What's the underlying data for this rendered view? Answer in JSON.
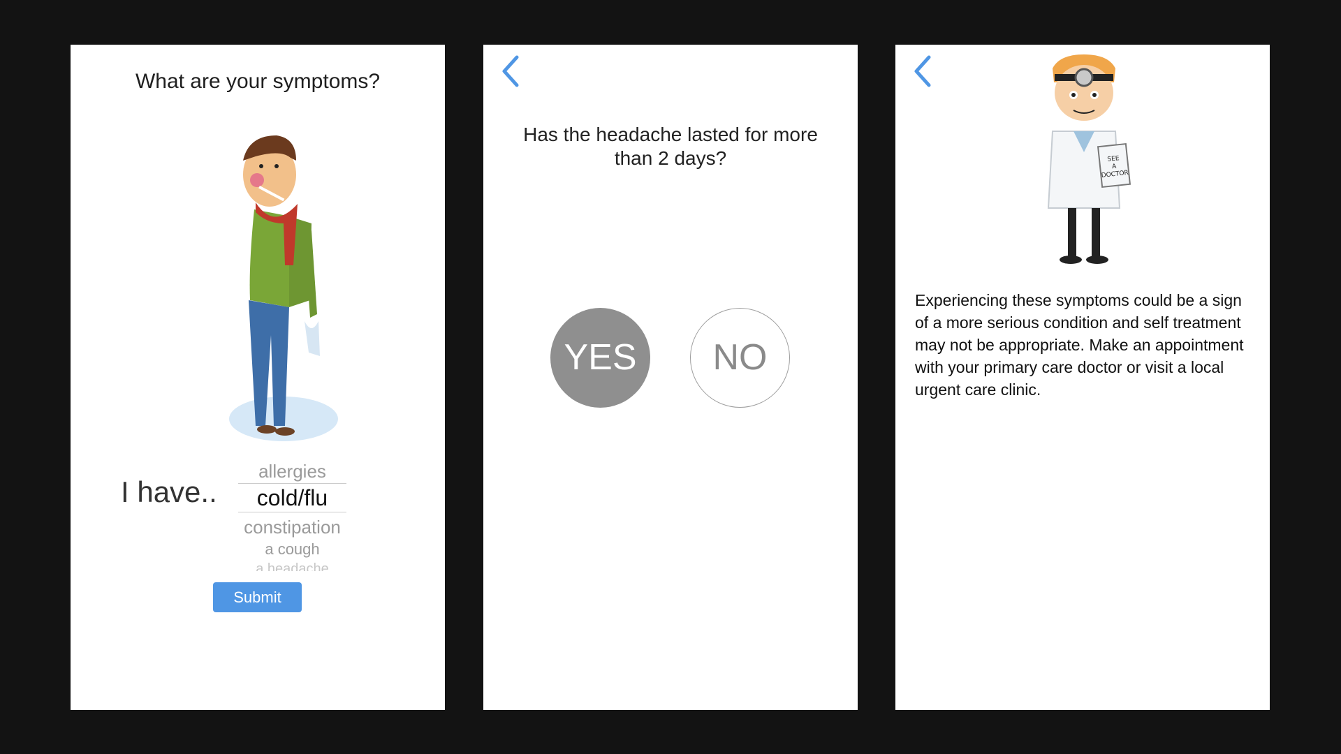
{
  "screen1": {
    "title": "What are your symptoms?",
    "prefix": "I have..",
    "picker_options": [
      "allergies",
      "cold/flu",
      "constipation",
      "a cough",
      "a headache"
    ],
    "selected": "cold/flu",
    "submit_label": "Submit"
  },
  "screen2": {
    "question": "Has the headache lasted for more than 2 days?",
    "yes_label": "YES",
    "no_label": "NO"
  },
  "screen3": {
    "sign_text": "SEE A DOCTOR",
    "message": "Experiencing these symptoms could be a sign of a more serious condition and self treatment may not be appropriate. Make an appointment with your primary care doctor or visit a local urgent care clinic."
  },
  "colors": {
    "background": "#131313",
    "accent_blue": "#4f96e4",
    "yes_fill": "#8f8f8f"
  },
  "icons": [
    "chevron-left-icon"
  ]
}
